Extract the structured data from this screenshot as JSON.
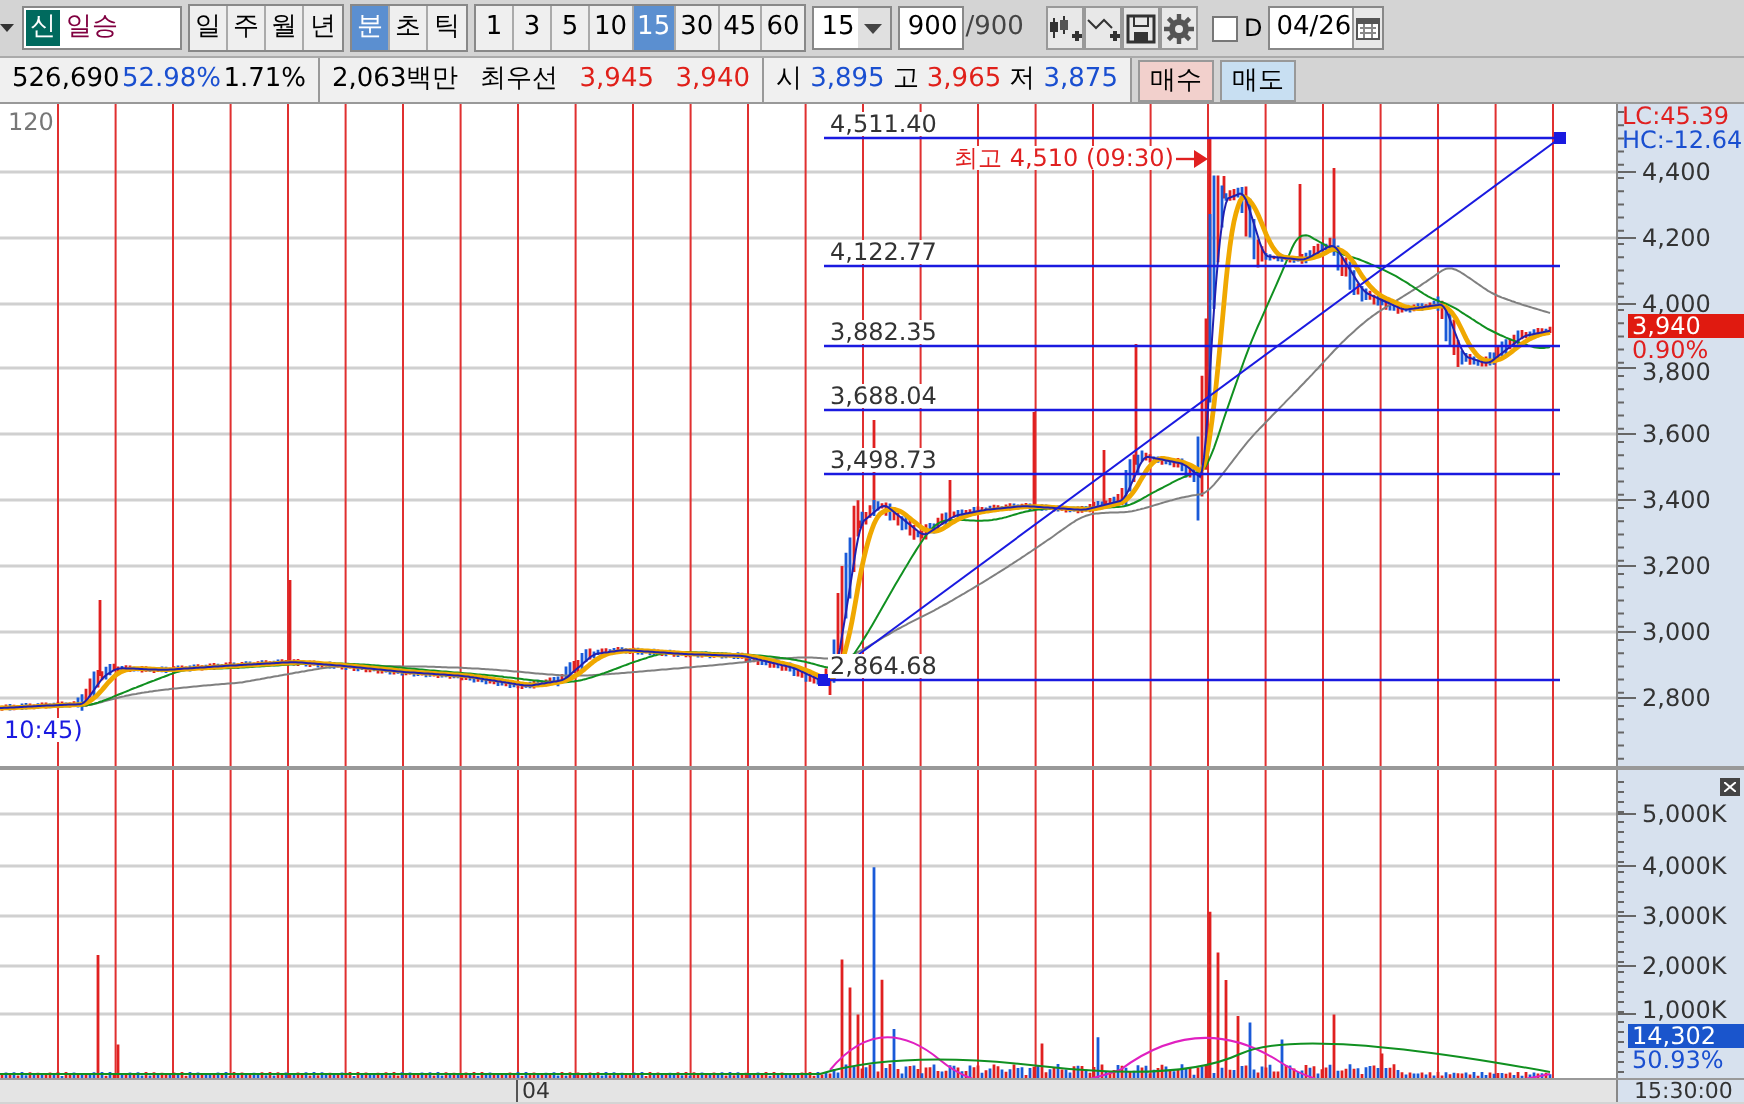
{
  "toolbar": {
    "stock": {
      "market_badge": "신",
      "name": "일승"
    },
    "period_groups": [
      {
        "items": [
          {
            "label": "일",
            "selected": false
          },
          {
            "label": "주",
            "selected": false
          },
          {
            "label": "월",
            "selected": false
          },
          {
            "label": "년",
            "selected": false
          }
        ]
      },
      {
        "items": [
          {
            "label": "분",
            "selected": true
          },
          {
            "label": "초",
            "selected": false
          },
          {
            "label": "틱",
            "selected": false
          }
        ]
      }
    ],
    "intervals": [
      {
        "label": "1",
        "selected": false
      },
      {
        "label": "3",
        "selected": false
      },
      {
        "label": "5",
        "selected": false
      },
      {
        "label": "10",
        "selected": false
      },
      {
        "label": "15",
        "selected": true
      },
      {
        "label": "30",
        "selected": false
      },
      {
        "label": "45",
        "selected": false
      },
      {
        "label": "60",
        "selected": false
      }
    ],
    "interval_select": "15",
    "count": "900",
    "count_total": "/900",
    "date_checkbox": {
      "label": "D",
      "checked": false
    },
    "date": "04/26"
  },
  "quote_bar": {
    "groups": [
      [
        {
          "text": "526,690",
          "color": "#000000"
        },
        {
          "text": "52.98%",
          "color": "#1a4fd0"
        },
        {
          "text": "1.71%",
          "color": "#000000"
        }
      ],
      [
        {
          "text": "2,063백만",
          "color": "#000000"
        },
        {
          "text": "최우선",
          "color": "#000000"
        },
        {
          "text": "3,945",
          "color": "#e0201a"
        },
        {
          "text": "3,940",
          "color": "#e0201a"
        }
      ],
      [
        {
          "text": "시",
          "color": "#000000"
        },
        {
          "text": "3,895",
          "color": "#1a4fd0"
        },
        {
          "text": "고",
          "color": "#000000"
        },
        {
          "text": "3,965",
          "color": "#e0201a"
        },
        {
          "text": "저",
          "color": "#000000"
        },
        {
          "text": "3,875",
          "color": "#1a4fd0"
        }
      ]
    ],
    "buttons": [
      {
        "label": "매수",
        "kind": "buy"
      },
      {
        "label": "매도",
        "kind": "sell"
      }
    ]
  },
  "price_chart": {
    "period_label": "120",
    "time_note": "10:45)",
    "fib_levels": [
      "4,511.40",
      "4,122.77",
      "3,882.35",
      "3,688.04",
      "3,498.73",
      "2,864.68"
    ],
    "peak_note": "최고 4,510 (09:30)",
    "lc": "LC:45.39",
    "hc": "HC:-12.64",
    "axis_labels": [
      "4,400",
      "4,200",
      "4,000",
      "3,800",
      "3,600",
      "3,400",
      "3,200",
      "3,000",
      "2,800"
    ],
    "current_price": "3,940",
    "change_pct": "0.90%"
  },
  "volume_chart": {
    "axis_labels": [
      "5,000K",
      "4,000K",
      "3,000K",
      "2,000K",
      "1,000K"
    ],
    "current_volume": "14,302",
    "volume_pct": "50.93%"
  },
  "time_axis": {
    "labels": [
      "04"
    ],
    "current_time": "15:30:00"
  }
}
